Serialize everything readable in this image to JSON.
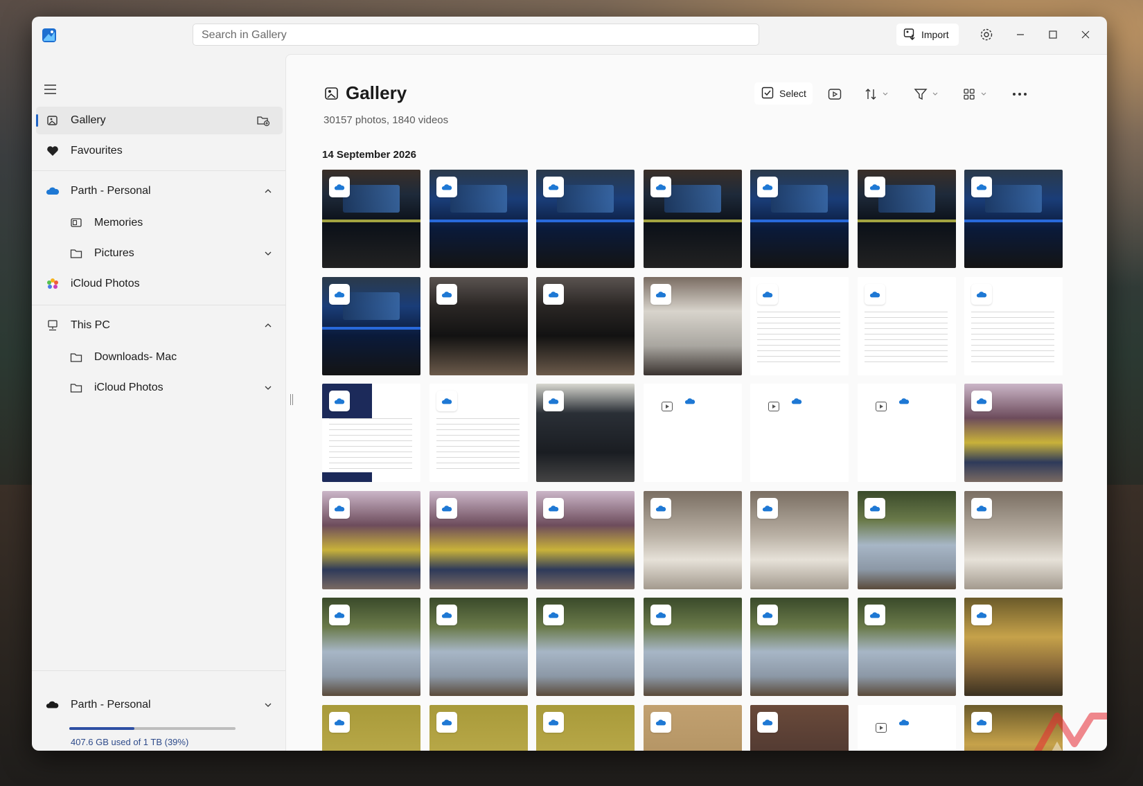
{
  "search": {
    "placeholder": "Search in Gallery"
  },
  "titlebar": {
    "import_label": "Import"
  },
  "sidebar": {
    "items": [
      {
        "label": "Gallery",
        "icon": "gallery-icon"
      },
      {
        "label": "Favourites",
        "icon": "heart-icon"
      },
      {
        "label": "Parth - Personal",
        "icon": "onedrive-cloud-icon"
      },
      {
        "label": "Memories",
        "icon": "memories-icon"
      },
      {
        "label": "Pictures",
        "icon": "folder-icon"
      },
      {
        "label": "iCloud Photos",
        "icon": "icloud-photos-icon"
      },
      {
        "label": "This PC",
        "icon": "pc-icon"
      },
      {
        "label": "Downloads- Mac",
        "icon": "folder-icon"
      },
      {
        "label": "iCloud Photos",
        "icon": "folder-icon"
      }
    ],
    "storage": {
      "account": "Parth - Personal",
      "usage_text": "407.6 GB used of 1 TB (39%)",
      "used_fraction": 0.39
    }
  },
  "main": {
    "title": "Gallery",
    "subtitle": "30157 photos, 1840 videos",
    "select_label": "Select",
    "date_group": "14 September 2026"
  },
  "colors": {
    "accent": "#1f63c4",
    "onedrive": "#1e78d4",
    "storage_fill": "#2d4fa3"
  },
  "tiles": [
    "car",
    "car-blue",
    "car-blue",
    "car",
    "car-blue",
    "car",
    "car-blue",
    "car-blue",
    "monitor",
    "monitor",
    "monitor2",
    "doc",
    "doc",
    "doc",
    "doc-dark",
    "doc",
    "laptop",
    "video",
    "video",
    "video",
    "group",
    "group",
    "group",
    "group",
    "baby",
    "baby",
    "dress",
    "baby",
    "dress",
    "dress",
    "dress",
    "dress",
    "dress",
    "dress",
    "stage",
    "warm",
    "warm",
    "warm",
    "tan",
    "dark",
    "video",
    "stage"
  ]
}
